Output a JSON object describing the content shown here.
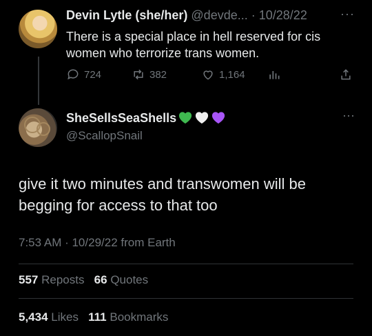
{
  "tweet1": {
    "display_name": "Devin Lytle (she/her)",
    "handle": "@devde...",
    "separator": "·",
    "date": "10/28/22",
    "more": "···",
    "text": "There is a special place in hell reserved for cis women who terrorize trans women.",
    "replies": "724",
    "retweets": "382",
    "likes": "1,164"
  },
  "tweet2": {
    "display_name": "SheSellsSeaShells",
    "handle": "@ScallopSnail",
    "more": "···",
    "heart_colors": [
      "#3fb950",
      "#f0f0f0",
      "#a855f7"
    ],
    "text": "give it two minutes and transwomen will be begging for access to that too",
    "timestamp": "7:53 AM · 10/29/22 from Earth",
    "reposts_count": "557",
    "reposts_label": "Reposts",
    "quotes_count": "66",
    "quotes_label": "Quotes",
    "likes_count": "5,434",
    "likes_label": "Likes",
    "bookmarks_count": "111",
    "bookmarks_label": "Bookmarks"
  }
}
